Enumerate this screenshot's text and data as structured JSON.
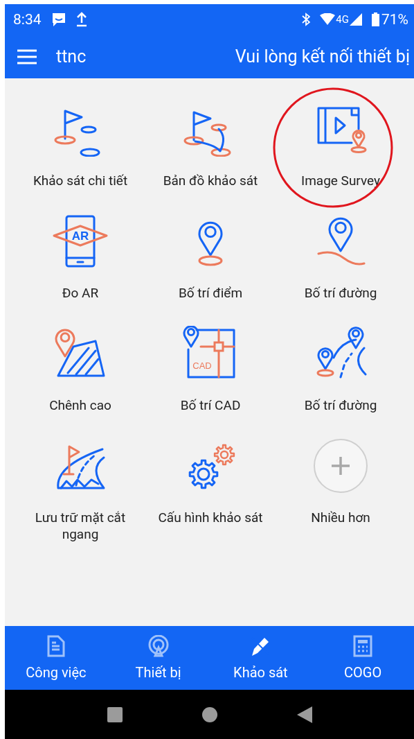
{
  "status_bar": {
    "time": "8:34",
    "network": "4G",
    "battery": "71%"
  },
  "app_bar": {
    "title": "ttnc",
    "status": "Vui lòng kết nối thiết bị"
  },
  "features": [
    {
      "label": "Khảo sát chi tiết",
      "highlighted": false
    },
    {
      "label": "Bản đồ khảo sát",
      "highlighted": false
    },
    {
      "label": "Image Survey",
      "highlighted": true
    },
    {
      "label": "Đo AR",
      "highlighted": false
    },
    {
      "label": "Bố trí điểm",
      "highlighted": false
    },
    {
      "label": "Bố trí đường",
      "highlighted": false
    },
    {
      "label": "Chênh cao",
      "highlighted": false
    },
    {
      "label": "Bố trí CAD",
      "highlighted": false
    },
    {
      "label": "Bố trí đường",
      "highlighted": false
    },
    {
      "label": "Lưu trữ mặt cắt ngang",
      "highlighted": false
    },
    {
      "label": "Cấu hình khảo sát",
      "highlighted": false
    },
    {
      "label": "Nhiều hơn",
      "highlighted": false
    }
  ],
  "ar_badge": "AR",
  "cad_badge": "CAD",
  "bottom_nav": [
    {
      "label": "Công việc",
      "selected": false
    },
    {
      "label": "Thiết bị",
      "selected": false
    },
    {
      "label": "Khảo sát",
      "selected": true
    },
    {
      "label": "COGO",
      "selected": false
    }
  ]
}
